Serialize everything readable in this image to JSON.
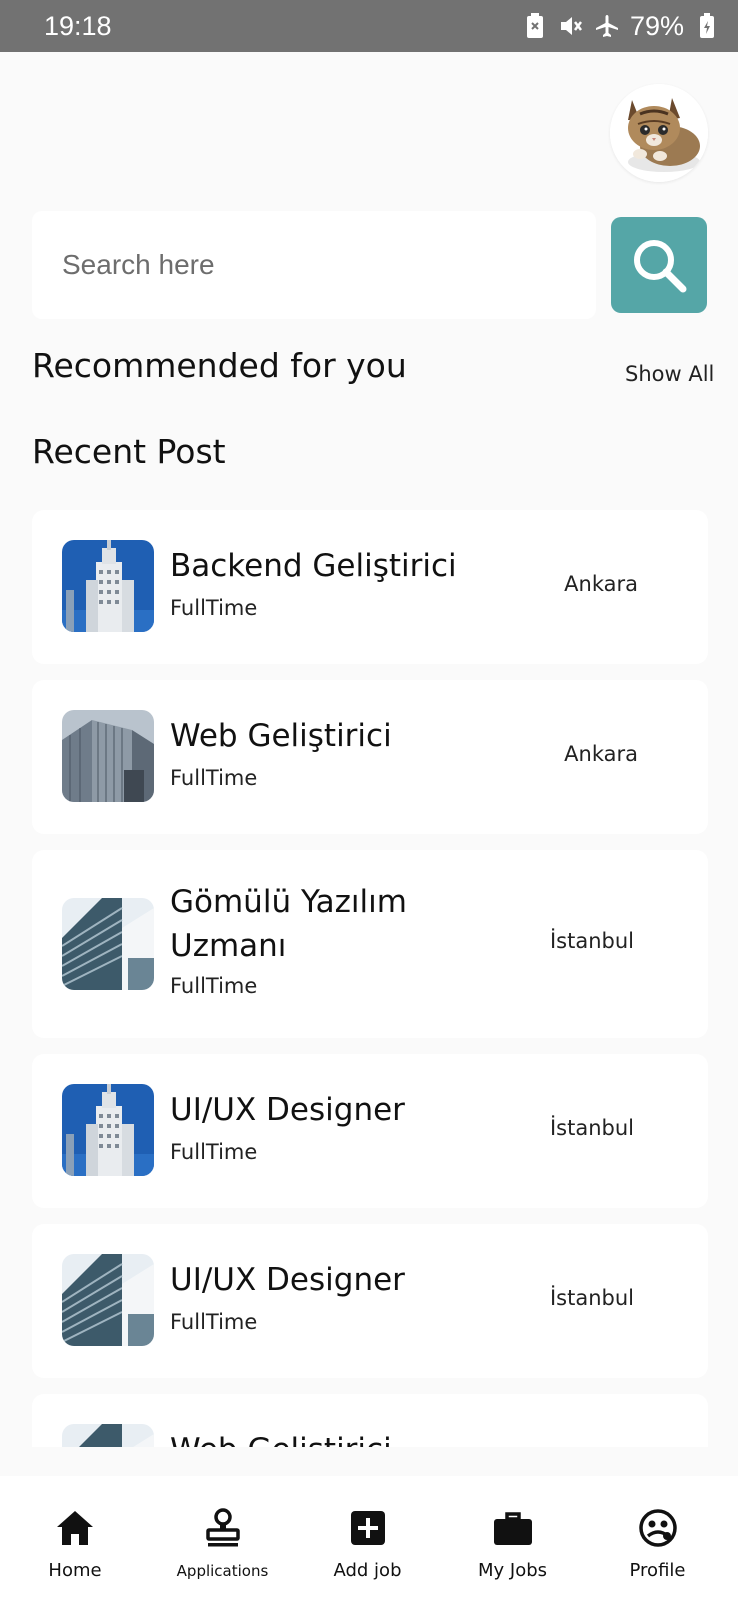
{
  "status": {
    "time": "19:18",
    "battery": "79%",
    "icons": [
      "battery-saver-icon",
      "mute-icon",
      "airplane-icon",
      "battery-icon"
    ]
  },
  "profile": {
    "avatar": "cat-avatar"
  },
  "search": {
    "placeholder": "Search here",
    "button_icon": "search-icon",
    "accent": "#55a6a7"
  },
  "sections": {
    "recommended": "Recommended for you",
    "show_all": "Show All",
    "recent": "Recent Post"
  },
  "jobs": [
    {
      "title": "Backend Geliştirici",
      "type": "FullTime",
      "city": "Ankara",
      "thumb": "building-blue"
    },
    {
      "title": "Web Geliştirici",
      "type": "FullTime",
      "city": "Ankara",
      "thumb": "building-glass"
    },
    {
      "title": "Gömülü Yazılım Uzmanı",
      "type": "FullTime",
      "city": "İstanbul",
      "thumb": "building-tower"
    },
    {
      "title": "UI/UX Designer",
      "type": "FullTime",
      "city": "İstanbul",
      "thumb": "building-blue"
    },
    {
      "title": "UI/UX Designer",
      "type": "FullTime",
      "city": "İstanbul",
      "thumb": "building-tower"
    },
    {
      "title": "Web Geliştirici",
      "type": "",
      "city": "",
      "thumb": "building-tower"
    }
  ],
  "nav": [
    {
      "label": "Home",
      "icon": "home-icon"
    },
    {
      "label": "Applications",
      "icon": "stamp-icon"
    },
    {
      "label": "Add job",
      "icon": "add-box-icon"
    },
    {
      "label": "My Jobs",
      "icon": "briefcase-icon"
    },
    {
      "label": "Profile",
      "icon": "face-icon"
    }
  ]
}
